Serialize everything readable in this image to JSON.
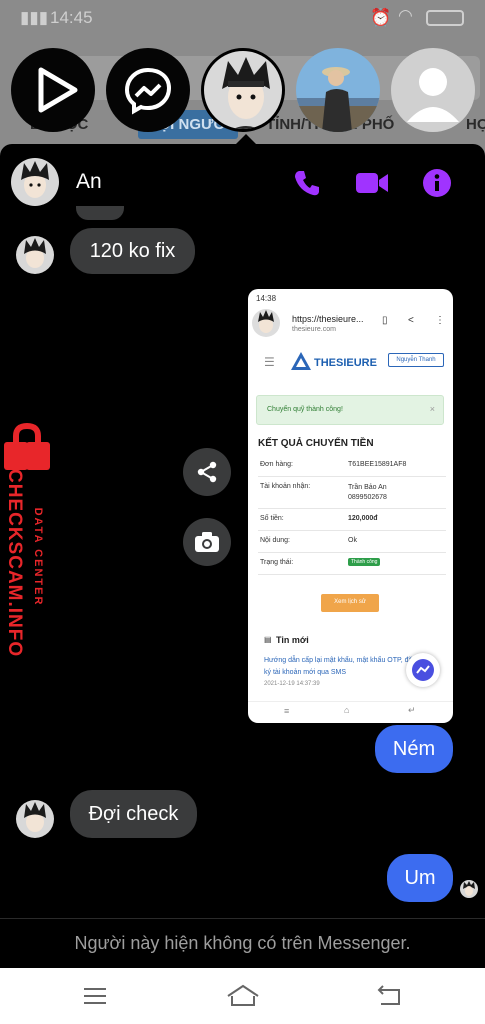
{
  "status_bar": {
    "time": "14:45"
  },
  "background_tabs": [
    "BỘ LỌC",
    "MỌI NGƯỜI",
    "TỈNH/THÀNH PHỐ",
    "HỌ"
  ],
  "chat_heads": [
    "play-head",
    "messenger-head",
    "ninja-avatar-head",
    "person-photo-head",
    "default-user-head"
  ],
  "header": {
    "name": "An"
  },
  "messages": [
    {
      "from": "them",
      "text": "120 ko fix"
    },
    {
      "from": "me",
      "text": "Ném"
    },
    {
      "from": "them",
      "text": "Đợi check"
    },
    {
      "from": "me",
      "text": "Um"
    }
  ],
  "shared_screenshot": {
    "status_time": "14:38",
    "url": "https://thesieure...",
    "domain": "thesieure.com",
    "brand": "THESIEURE",
    "user_button": "Nguyễn Thanh",
    "alert": "Chuyển quỹ thành công!",
    "heading": "KẾT QUẢ CHUYỂN TIỀN",
    "rows": [
      {
        "label": "Đơn hàng:",
        "value": "T61BEE15891AF8"
      },
      {
        "label": "Tài khoản nhận:",
        "value": "Trần Bảo An\n0899502678"
      },
      {
        "label": "Số tiền:",
        "value": "120,000đ"
      },
      {
        "label": "Nội dung:",
        "value": "Ok"
      },
      {
        "label": "Trạng thái:",
        "value": "Thành công"
      }
    ],
    "history_button": "Xem lịch sử",
    "news_title": "Tin mới",
    "news_link": "Hướng dẫn cấp lại mật khẩu, mật khẩu OTP, đăng ký tài khoản mới qua SMS",
    "news_date": "2021-12-19 14:37:39"
  },
  "watermark": {
    "line1": "DATA CENTER",
    "line2": "CHECKSCAM.INFO"
  },
  "footer_text": "Người này hiện không có trên Messenger.",
  "colors": {
    "accent": "#a033ff",
    "bubble_out": "#3c6cf0",
    "bubble_in": "#3a3b3c",
    "watermark": "#e8262a"
  }
}
